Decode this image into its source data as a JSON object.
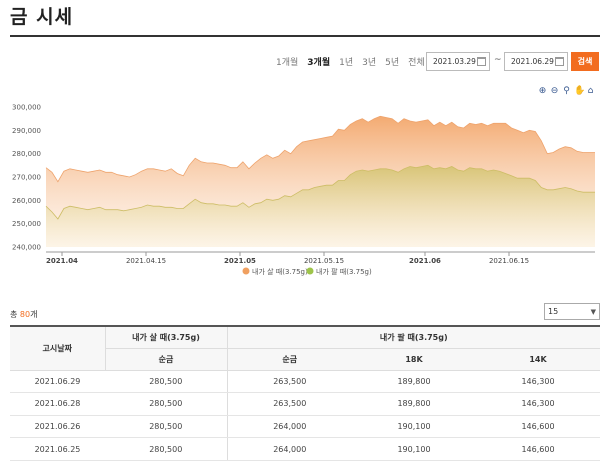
{
  "page": {
    "title": "금 시세"
  },
  "period_tabs": [
    {
      "label": "1개월",
      "active": false
    },
    {
      "label": "3개월",
      "active": true
    },
    {
      "label": "1년",
      "active": false
    },
    {
      "label": "3년",
      "active": false
    },
    {
      "label": "5년",
      "active": false
    },
    {
      "label": "전체",
      "active": false
    }
  ],
  "date_range": {
    "start": "2021.03.29",
    "separator": "~",
    "end": "2021.06.29"
  },
  "search_button": "검색",
  "chart_tools": [
    "zoom-in-icon",
    "zoom-out-icon",
    "magnifier-icon",
    "pan-hand-icon",
    "home-icon"
  ],
  "chart_data": {
    "type": "area",
    "y_ticks": [
      "300,000",
      "290,000",
      "280,000",
      "270,000",
      "260,000",
      "250,000",
      "240,000"
    ],
    "x_ticks": [
      "2021.04",
      "2021.04.15",
      "2021.05",
      "2021.05.15",
      "2021.06",
      "2021.06.15"
    ],
    "ylim": [
      240000,
      300000
    ],
    "grid": false,
    "legend_position": "bottom",
    "series": [
      {
        "name": "내가 살 때(3.75g)",
        "color": "#f0a060",
        "values": [
          274000,
          272000,
          268000,
          272500,
          273500,
          273000,
          272500,
          272000,
          272500,
          273000,
          272000,
          272000,
          271000,
          270500,
          270000,
          271000,
          272500,
          273500,
          273500,
          273000,
          272500,
          273500,
          271500,
          270500,
          275000,
          278000,
          276500,
          276000,
          276000,
          275500,
          275000,
          274000,
          274000,
          276500,
          273500,
          276000,
          278000,
          279500,
          278000,
          279000,
          281500,
          280000,
          283000,
          285000,
          285500,
          286000,
          286500,
          287000,
          287500,
          290500,
          290000,
          292500,
          294000,
          295000,
          293500,
          295000,
          296000,
          295500,
          295000,
          293000,
          295000,
          294000,
          293500,
          294000,
          294500,
          292000,
          293500,
          292000,
          293500,
          291500,
          291000,
          293000,
          292500,
          293000,
          292000,
          293000,
          293000,
          293000,
          291000,
          290000,
          289000,
          290000,
          289500,
          285500,
          280000,
          280500,
          282000,
          283000,
          282500,
          281000,
          280500,
          280500,
          280500
        ]
      },
      {
        "name": "내가 팔 때(3.75g)",
        "color": "#c8c060",
        "values": [
          257500,
          255000,
          252000,
          256500,
          257500,
          257000,
          256500,
          256000,
          256500,
          257000,
          256000,
          256000,
          256000,
          255500,
          256000,
          256500,
          257000,
          258000,
          257500,
          257500,
          257000,
          257000,
          256500,
          256500,
          258500,
          260500,
          259000,
          258500,
          258500,
          258000,
          258000,
          257500,
          257500,
          259000,
          257000,
          258500,
          259000,
          260500,
          260000,
          260500,
          262000,
          261500,
          263000,
          264500,
          264500,
          265500,
          266000,
          266500,
          266500,
          268500,
          268500,
          271000,
          272500,
          273000,
          272500,
          273000,
          273500,
          273500,
          273000,
          272000,
          273500,
          274500,
          274000,
          274500,
          275000,
          273500,
          274000,
          273500,
          274500,
          273000,
          272500,
          274000,
          273500,
          273500,
          272500,
          273000,
          272500,
          271500,
          270500,
          269500,
          269500,
          269500,
          268500,
          265500,
          264500,
          264500,
          265000,
          265500,
          265000,
          264000,
          263500,
          263500,
          263500
        ]
      }
    ]
  },
  "count": {
    "prefix": "총 ",
    "number": "80",
    "suffix": "개"
  },
  "page_size": "15",
  "table": {
    "header_date": "고시날짜",
    "group_buy": "내가 살 때(3.75g)",
    "group_sell": "내가 팔 때(3.75g)",
    "col_buy_pure": "순금",
    "col_sell_pure": "순금",
    "col_18k": "18K",
    "col_14k": "14K",
    "rows": [
      [
        "2021.06.29",
        "280,500",
        "263,500",
        "189,800",
        "146,300"
      ],
      [
        "2021.06.28",
        "280,500",
        "263,500",
        "189,800",
        "146,300"
      ],
      [
        "2021.06.26",
        "280,500",
        "264,000",
        "190,100",
        "146,600"
      ],
      [
        "2021.06.25",
        "280,500",
        "264,000",
        "190,100",
        "146,600"
      ]
    ]
  }
}
